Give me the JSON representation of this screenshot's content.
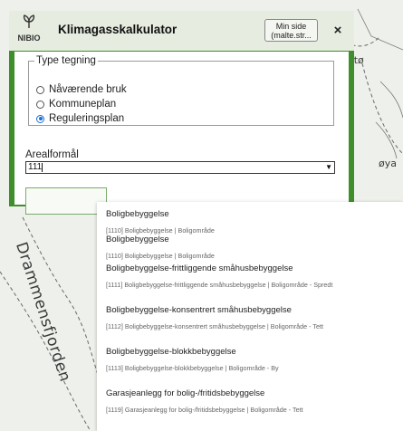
{
  "map": {
    "labels": {
      "fjord": "Drammensfjorden",
      "north": "stø",
      "east": "øya"
    }
  },
  "panel": {
    "logo_text": "NIBIO",
    "title": "Klimagasskalkulator",
    "my_page_line1": "Min side",
    "my_page_line2": "(malte.str...",
    "close_label": "×",
    "drawing_type": {
      "legend": "Type tegning",
      "options": [
        "Nåværende bruk",
        "Kommuneplan",
        "Reguleringsplan"
      ],
      "selected": "Reguleringsplan"
    },
    "area_purpose": {
      "label": "Arealformål",
      "value": "111"
    }
  },
  "dropdown": {
    "items": [
      {
        "title": "Boligbebyggelse",
        "subtitle": "[1110] Boligbebyggelse | Boligområde"
      },
      {
        "title": "Boligbebyggelse",
        "subtitle": "[1110] Boligbebyggelse | Boligområde"
      },
      {
        "title": "Boligbebyggelse-frittliggende småhusbebyggelse",
        "subtitle": "[1111] Boligbebyggelse-frittliggende småhusbebyggelse | Boligområde - Spredt"
      },
      {
        "title": "Boligbebyggelse-konsentrert småhusbebyggelse",
        "subtitle": "[1112] Boligbebyggelse-konsentrert småhusbebyggelse | Boligområde - Tett"
      },
      {
        "title": "Boligbebyggelse-blokkbebyggelse",
        "subtitle": "[1113] Boligbebyggelse-blokkbebyggelse | Boligområde - By"
      },
      {
        "title": "Garasjeanlegg for bolig-/fritidsbebyggelse",
        "subtitle": "[1119] Garasjeanlegg for bolig-/fritidsbebyggelse | Boligområde - Tett"
      }
    ]
  },
  "colors": {
    "panel_green": "#3e8e2c",
    "header_bg": "#e6ecdf",
    "radio_selected": "#1a6ed8"
  }
}
